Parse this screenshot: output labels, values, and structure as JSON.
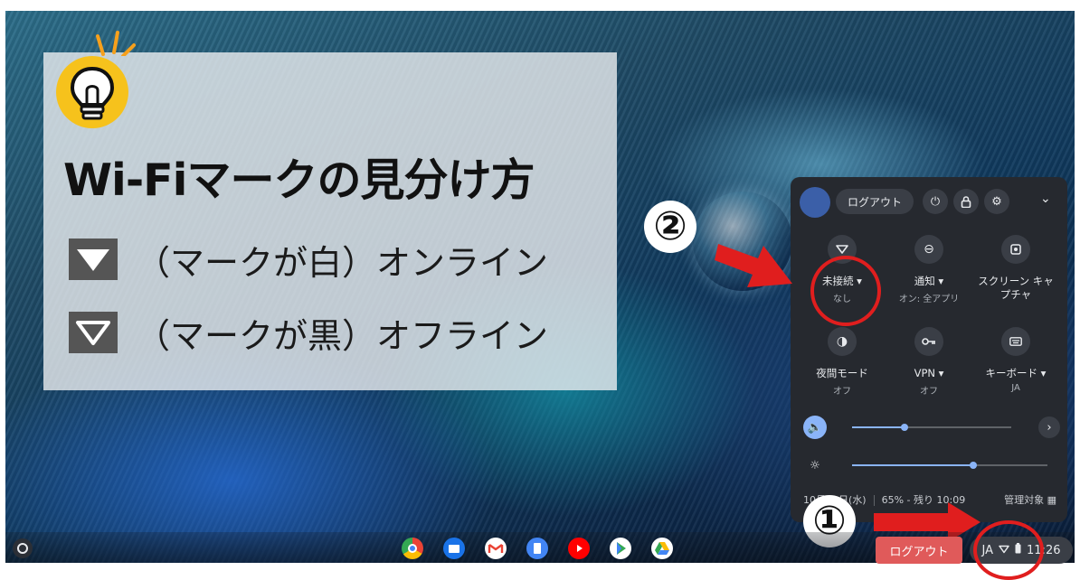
{
  "overlay": {
    "title": "Wi-Fiマークの見分け方",
    "row_white_text": "（マークが白）オンライン",
    "row_black_text": "（マークが黒）オフライン"
  },
  "markers": {
    "step1": "①",
    "step2": "②"
  },
  "quick_settings": {
    "logout_label": "ログアウト",
    "tiles": [
      {
        "label": "未接続 ▾",
        "sub": "なし",
        "icon": "wifi-outline-icon"
      },
      {
        "label": "通知 ▾",
        "sub": "オン: 全アプリ",
        "icon": "notification-icon"
      },
      {
        "label": "スクリーン キャプチャ",
        "sub": "",
        "icon": "screen-capture-icon"
      },
      {
        "label": "夜間モード",
        "sub": "オフ",
        "icon": "night-mode-icon"
      },
      {
        "label": "VPN ▾",
        "sub": "オフ",
        "icon": "vpn-key-icon"
      },
      {
        "label": "キーボード ▾",
        "sub": "JA",
        "icon": "keyboard-icon"
      }
    ],
    "volume_level": 0.33,
    "brightness_level": 0.62,
    "footer_date": "10月29日(水)",
    "footer_battery": "65% - 残り 10:09",
    "footer_managed": "管理対象"
  },
  "shelf": {
    "logout_label": "ログアウト",
    "ime": "JA",
    "time": "11:26",
    "apps": [
      "chrome-icon",
      "files-icon",
      "gmail-icon",
      "docs-icon",
      "youtube-icon",
      "play-store-icon",
      "drive-icon"
    ]
  },
  "colors": {
    "highlight_red": "#e01e1e",
    "panel_bg": "#26292f",
    "accent_blue": "#8ab4f8",
    "bulb_yellow": "#f6c21c"
  }
}
